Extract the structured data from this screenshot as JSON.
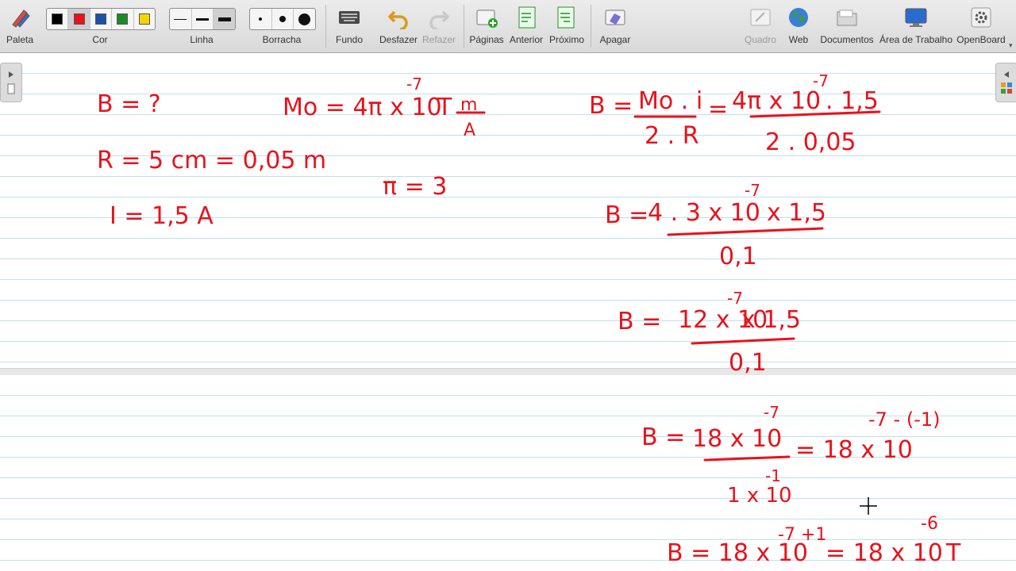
{
  "toolbar": {
    "palette_label": "Paleta",
    "color_label": "Cor",
    "line_label": "Linha",
    "eraser_label": "Borracha",
    "background_label": "Fundo",
    "undo_label": "Desfazer",
    "redo_label": "Refazer",
    "pages_label": "Páginas",
    "previous_label": "Anterior",
    "next_label": "Próximo",
    "erase_label": "Apagar",
    "board_label": "Quadro",
    "web_label": "Web",
    "documents_label": "Documentos",
    "desktop_label": "Área de Trabalho",
    "app_label": "OpenBoard",
    "colors": [
      "#000000",
      "#e8121b",
      "#1d4fa8",
      "#1d8a2a",
      "#f2d600"
    ],
    "selected_color_index": 1
  },
  "notes": {
    "b_unknown": "B = ?",
    "radius": "R = 5 cm = 0,05 m",
    "current": "I = 1,5 A",
    "mu0_lhs": "Mo = 4π x 10",
    "mu0_exp": "-7",
    "mu0_unit_t": "T",
    "mu0_unit_num": "m",
    "mu0_unit_den": "A",
    "pi_eq": "π = 3",
    "b_formula_lhs": "B =",
    "b_formula_num": "Mo . i",
    "b_formula_den": "2 . R",
    "b_sub_eq": "=",
    "b_sub_num": "4π x 10",
    "b_sub_num_exp": "-7",
    "b_sub_num_tail": ". 1,5",
    "b_sub_den": "2 . 0,05",
    "step2_lhs": "B =",
    "step2_num": "4 . 3 x 10",
    "step2_num_exp": "-7",
    "step2_num_tail": "x 1,5",
    "step2_den": "0,1",
    "step3_lhs": "B =",
    "step3_num": "12 x 10",
    "step3_num_exp": "-7",
    "step3_num_tail": "x 1,5",
    "step3_den": "0,1",
    "step4_lhs": "B =",
    "step4_num": "18 x 10",
    "step4_num_exp": "-7",
    "step4_den": "1 x 10",
    "step4_den_exp": "-1",
    "step4_rhs": "= 18 x 10",
    "step4_rhs_exp": "-7 - (-1)",
    "step5_lhs": "B = 18 x 10",
    "step5_exp": "-7 +1",
    "step5_rhs": "= 18 x 10",
    "step5_rhs_exp": "-6",
    "step5_unit": "T"
  }
}
